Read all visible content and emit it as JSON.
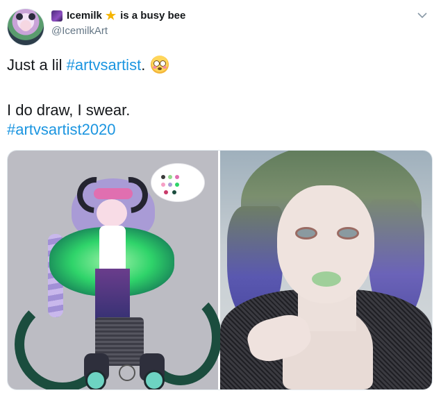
{
  "user": {
    "display_name": "Icemilk",
    "status_text": "is a busy bee",
    "handle": "@IcemilkArt"
  },
  "icons": {
    "avatar": "profile-avatar",
    "name_emoji": "purple-galaxy-emoji",
    "star": "star-emoji",
    "menu": "chevron-down-icon",
    "reaction": "flushed-face-emoji"
  },
  "colors": {
    "hashtag": "#1b95e0",
    "text": "#14171a",
    "secondary": "#657786"
  },
  "tweet": {
    "line1_prefix": "Just a lil ",
    "line1_hashtag": "#artvsartist",
    "line1_suffix": ".",
    "line2": "I do draw, I swear.",
    "line3_hashtag": "#artvsartist2020"
  },
  "media": {
    "images": [
      {
        "subject": "digital drawing of character"
      },
      {
        "subject": "selfie photo of artist"
      }
    ]
  }
}
